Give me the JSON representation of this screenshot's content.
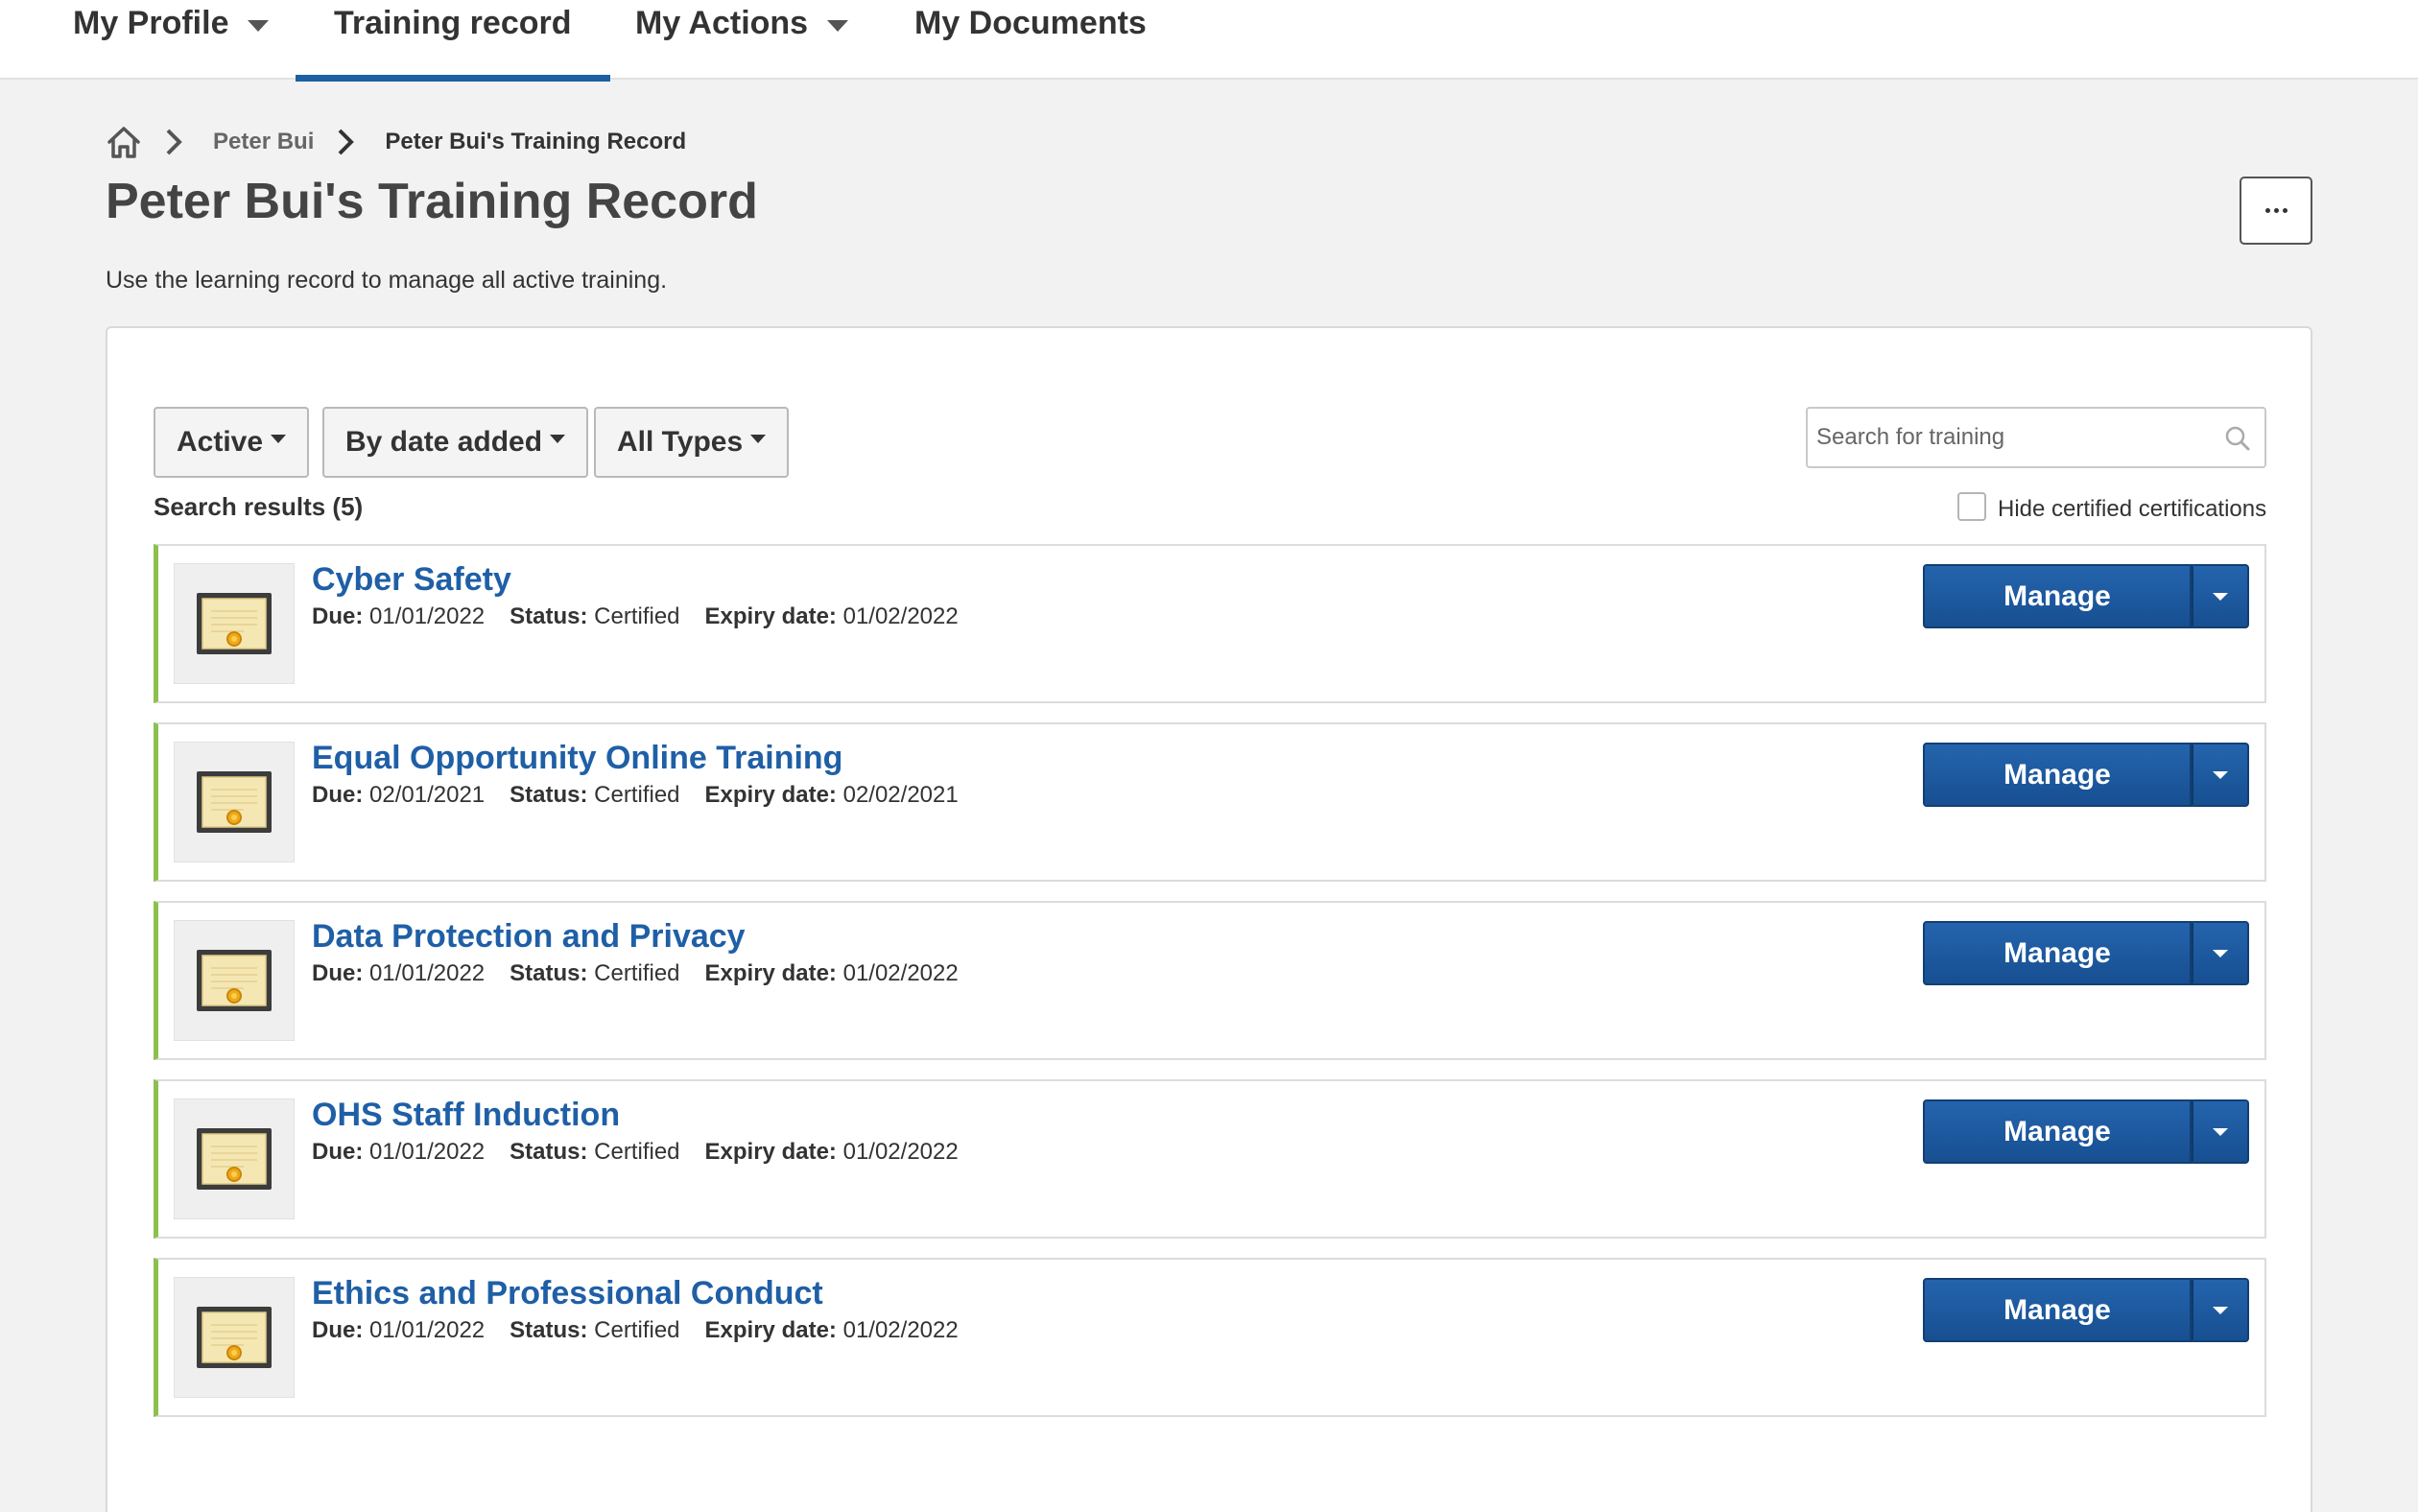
{
  "nav": {
    "items": [
      {
        "label": "My Profile",
        "has_dropdown": true,
        "active": false
      },
      {
        "label": "Training record",
        "has_dropdown": false,
        "active": true
      },
      {
        "label": "My Actions",
        "has_dropdown": true,
        "active": false
      },
      {
        "label": "My Documents",
        "has_dropdown": false,
        "active": false
      }
    ]
  },
  "breadcrumb": {
    "home_icon": "home-icon",
    "items": [
      "Peter Bui",
      "Peter Bui's Training Record"
    ]
  },
  "page": {
    "title": "Peter Bui's Training Record",
    "subtitle": "Use the learning record to manage all active training.",
    "more_icon": "ellipsis-icon"
  },
  "filters": {
    "status": "Active",
    "sort": "By date added",
    "type": "All Types"
  },
  "search": {
    "placeholder": "Search for training",
    "value": ""
  },
  "results": {
    "count_label": "Search results (5)",
    "hide_certified_label": "Hide certified certifications",
    "hide_certified_checked": false
  },
  "labels": {
    "due": "Due:",
    "status": "Status:",
    "expiry": "Expiry date:",
    "manage": "Manage"
  },
  "trainings": [
    {
      "title": "Cyber Safety",
      "due": "01/01/2022",
      "status": "Certified",
      "expiry": "01/02/2022"
    },
    {
      "title": "Equal Opportunity Online Training",
      "due": "02/01/2021",
      "status": "Certified",
      "expiry": "02/02/2021"
    },
    {
      "title": "Data Protection and Privacy",
      "due": "01/01/2022",
      "status": "Certified",
      "expiry": "01/02/2022"
    },
    {
      "title": "OHS Staff Induction",
      "due": "01/01/2022",
      "status": "Certified",
      "expiry": "01/02/2022"
    },
    {
      "title": "Ethics and Professional Conduct",
      "due": "01/01/2022",
      "status": "Certified",
      "expiry": "01/02/2022"
    }
  ],
  "colors": {
    "accent": "#1f5fa6",
    "status_bar": "#8cc04f",
    "manage_button": "#1c5aa0"
  }
}
